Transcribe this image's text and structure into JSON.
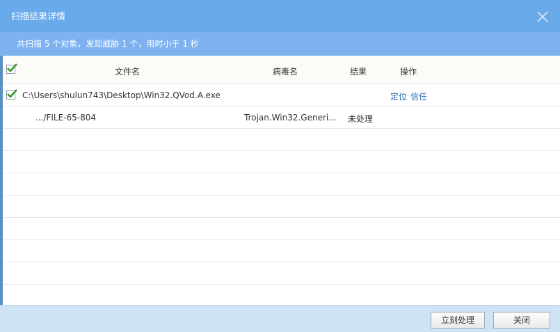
{
  "window": {
    "title": "扫描结果详情",
    "close_icon": "close-icon"
  },
  "summary": {
    "text": "共扫描 5 个对象，发现威胁 1 个，用时小于 1 秒"
  },
  "table": {
    "columns": {
      "filename": "文件名",
      "virus_name": "病毒名",
      "result": "结果",
      "action": "操作"
    },
    "header_checked": true,
    "file_row": {
      "checked": true,
      "path": "C:\\Users\\shulun743\\Desktop\\Win32.QVod.A.exe",
      "locate_label": "定位",
      "trust_label": "信任"
    },
    "detail_row": {
      "item": ".../FILE-65-804",
      "virus": "Trojan.Win32.Generi...",
      "status": "未处理"
    }
  },
  "footer": {
    "process_label": "立刻处理",
    "close_label": "关闭"
  },
  "colors": {
    "titlebar": "#68aaea",
    "summary_bar": "#7db1f0",
    "footer": "#cfe3f7",
    "link": "#2b6cb3",
    "check_green": "#3b9a2a"
  }
}
